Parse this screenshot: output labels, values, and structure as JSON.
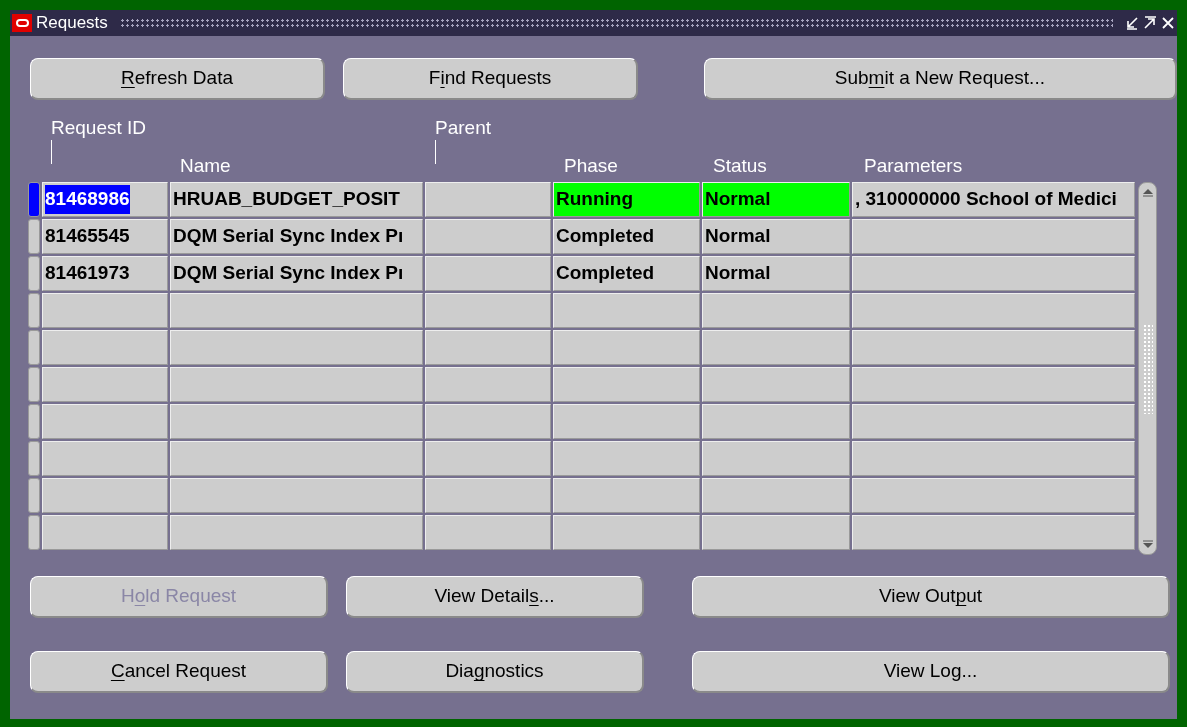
{
  "window": {
    "title": "Requests"
  },
  "top_buttons": [
    {
      "label": [
        {
          "text": "R",
          "underlined": true
        },
        {
          "text": "efresh Data",
          "underlined": false
        }
      ],
      "disabled": false
    },
    {
      "label": [
        {
          "text": "F",
          "underlined": false
        },
        {
          "text": "i",
          "underlined": true
        },
        {
          "text": "nd Requests",
          "underlined": false
        }
      ],
      "disabled": false
    },
    {
      "label": [
        {
          "text": "Sub",
          "underlined": false
        },
        {
          "text": "m",
          "underlined": true
        },
        {
          "text": "it a New Request...",
          "underlined": false
        }
      ],
      "disabled": false
    }
  ],
  "table": {
    "columns": {
      "request_id": "Request ID",
      "parent": "Parent",
      "name": "Name",
      "phase": "Phase",
      "status": "Status",
      "parameters": "Parameters"
    },
    "rows": [
      {
        "selected": true,
        "request_id": "81468986",
        "name": "HRUAB_BUDGET_POSIT",
        "phase": "Running",
        "status": "Normal",
        "parameters": ", 310000000 School of Medici",
        "color": "#00ff00"
      },
      {
        "selected": false,
        "request_id": "81465545",
        "name": "DQM Serial Sync Index Pı",
        "phase": "Completed",
        "status": "Normal",
        "color": "#cccccc"
      },
      {
        "selected": false,
        "request_id": "81461973",
        "name": "DQM Serial Sync Index Pı",
        "phase": "Completed",
        "status": "Normal",
        "color": "#cccccc"
      }
    ]
  },
  "bottom_buttons": [
    {
      "label": [
        {
          "text": "H",
          "underlined": false
        },
        {
          "text": "o",
          "underlined": true
        },
        {
          "text": "ld Request",
          "underlined": false
        }
      ],
      "disabled": true
    },
    {
      "label": [
        {
          "text": "View Detail",
          "underlined": false
        },
        {
          "text": "s",
          "underlined": true
        },
        {
          "text": "...",
          "underlined": false
        }
      ],
      "disabled": false
    },
    {
      "label": [
        {
          "text": "View Out",
          "underlined": false
        },
        {
          "text": "p",
          "underlined": true
        },
        {
          "text": "ut",
          "underlined": false
        }
      ],
      "disabled": false
    },
    {
      "label": [
        {
          "text": "C",
          "underlined": true
        },
        {
          "text": "ancel Request",
          "underlined": false
        }
      ],
      "disabled": false
    },
    {
      "label": [
        {
          "text": "Dia",
          "underlined": false
        },
        {
          "text": "g",
          "underlined": true
        },
        {
          "text": "nostics",
          "underlined": false
        }
      ],
      "disabled": false
    },
    {
      "label": [
        {
          "text": "View Log...",
          "underlined": false
        }
      ],
      "disabled": false
    }
  ]
}
